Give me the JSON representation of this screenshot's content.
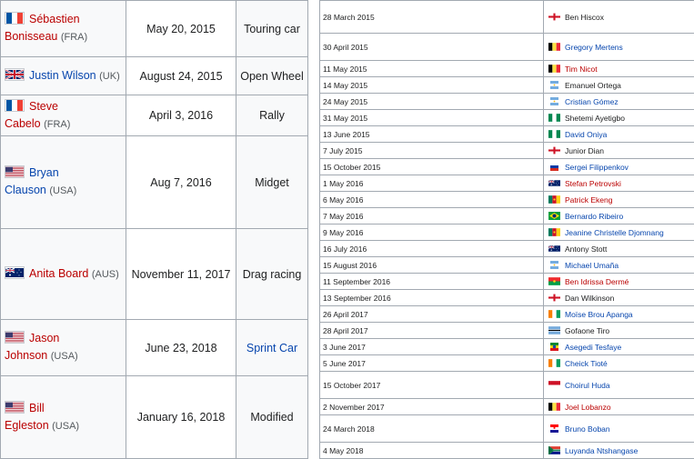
{
  "left_rows": [
    {
      "flag": "fr",
      "name_lines": [
        "Sébastien",
        "Bonisseau"
      ],
      "nat": "(FRA)",
      "link": "redlink",
      "date": "May 20, 2015",
      "category": "Touring car",
      "cat_link": false,
      "h": 62
    },
    {
      "flag": "uk",
      "name_lines": [
        "Justin Wilson"
      ],
      "nat": "(UK)",
      "link": "link",
      "date": "August 24, 2015",
      "category": "Open Wheel",
      "cat_link": false,
      "h": 42
    },
    {
      "flag": "fr",
      "name_lines": [
        "Steve",
        "Cabelo"
      ],
      "nat": "(FRA)",
      "link": "redlink",
      "date": "April 3, 2016",
      "category": "Rally",
      "cat_link": false,
      "h": 45
    },
    {
      "flag": "us",
      "name_lines": [
        "Bryan",
        "Clauson"
      ],
      "nat": "(USA)",
      "link": "link",
      "date": "Aug 7, 2016",
      "category": "Midget",
      "cat_link": false,
      "h": 102
    },
    {
      "flag": "au",
      "name_lines": [
        "Anita Board"
      ],
      "nat": "(AUS)",
      "link": "redlink",
      "date": "November 11, 2017",
      "category": "Drag racing",
      "cat_link": false,
      "h": 100
    },
    {
      "flag": "us",
      "name_lines": [
        "Jason",
        "Johnson"
      ],
      "nat": "(USA)",
      "link": "redlink",
      "date": "June 23, 2018",
      "category": "Sprint Car",
      "cat_link": true,
      "h": 62
    },
    {
      "flag": "us",
      "name_lines": [
        "Bill",
        "Egleston"
      ],
      "nat": "(USA)",
      "link": "redlink",
      "date": "January 16, 2018",
      "category": "Modified",
      "cat_link": false,
      "h": 91
    }
  ],
  "right_rows": [
    {
      "date": "28 March 2015",
      "flag": "en",
      "name": "Ben Hiscox",
      "link": "none",
      "h": 36
    },
    {
      "date": "30 April 2015",
      "flag": "be",
      "name": "Gregory Mertens",
      "link": "link",
      "h": 30
    },
    {
      "date": "11 May 2015",
      "flag": "be",
      "name": "Tim Nicot",
      "link": "redlink",
      "h": 18
    },
    {
      "date": "14 May 2015",
      "flag": "ar",
      "name": "Emanuel Ortega",
      "link": "none",
      "h": 18
    },
    {
      "date": "24 May 2015",
      "flag": "ar",
      "name": "Cristian Gómez",
      "link": "link",
      "h": 18
    },
    {
      "date": "31 May 2015",
      "flag": "ng",
      "name": "Shetemi Ayetigbo",
      "link": "none",
      "h": 18
    },
    {
      "date": "13 June 2015",
      "flag": "ng",
      "name": "David Oniya",
      "link": "link",
      "h": 18
    },
    {
      "date": "7 July 2015",
      "flag": "en",
      "name": "Junior Dian",
      "link": "none",
      "h": 18
    },
    {
      "date": "15 October 2015",
      "flag": "ru",
      "name": "Sergei Filippenkov",
      "link": "link",
      "h": 18
    },
    {
      "date": "1 May 2016",
      "flag": "au",
      "name": "Stefan Petrovski",
      "link": "redlink",
      "h": 18
    },
    {
      "date": "6 May 2016",
      "flag": "cm",
      "name": "Patrick Ekeng",
      "link": "redlink",
      "h": 18
    },
    {
      "date": "7 May 2016",
      "flag": "br",
      "name": "Bernardo Ribeiro",
      "link": "link",
      "h": 18
    },
    {
      "date": "9 May 2016",
      "flag": "cm",
      "name": "Jeanine Christelle Djomnang",
      "link": "link",
      "h": 18
    },
    {
      "date": "16 July 2016",
      "flag": "au",
      "name": "Antony Stott",
      "link": "none",
      "h": 18
    },
    {
      "date": "15 August 2016",
      "flag": "ar",
      "name": "Michael Umaña",
      "link": "link",
      "h": 18
    },
    {
      "date": "11 September 2016",
      "flag": "bf",
      "name": "Ben Idrissa Dermé",
      "link": "redlink",
      "h": 18
    },
    {
      "date": "13 September 2016",
      "flag": "en",
      "name": "Dan Wilkinson",
      "link": "none",
      "h": 18
    },
    {
      "date": "26 April 2017",
      "flag": "ci",
      "name": "Moïse Brou Apanga",
      "link": "link",
      "h": 18
    },
    {
      "date": "28 April 2017",
      "flag": "bw",
      "name": "Gofaone Tiro",
      "link": "none",
      "h": 18
    },
    {
      "date": "3 June 2017",
      "flag": "et",
      "name": "Asegedi Tesfaye",
      "link": "link",
      "h": 18
    },
    {
      "date": "5 June 2017",
      "flag": "ci",
      "name": "Cheick Tioté",
      "link": "link",
      "h": 18
    },
    {
      "date": "15 October 2017",
      "flag": "id",
      "name": "Choirul Huda",
      "link": "link",
      "h": 30
    },
    {
      "date": "2 November 2017",
      "flag": "be",
      "name": "Joel Lobanzo",
      "link": "redlink",
      "h": 18
    },
    {
      "date": "24 March 2018",
      "flag": "hr",
      "name": "Bruno Boban",
      "link": "link",
      "h": 30
    },
    {
      "date": "4 May 2018",
      "flag": "za",
      "name": "Luyanda Ntshangase",
      "link": "link",
      "h": 18
    }
  ]
}
